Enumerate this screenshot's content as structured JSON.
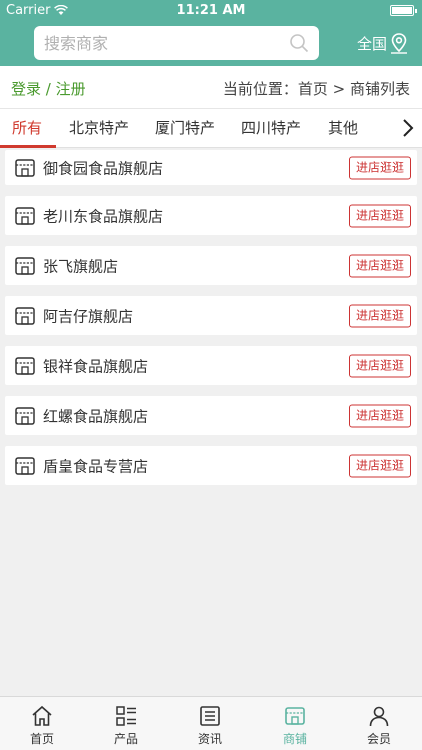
{
  "status_bar": {
    "carrier": "Carrier",
    "time": "11:21 AM"
  },
  "header": {
    "search": {
      "placeholder": "搜索商家",
      "icon": "search-icon"
    },
    "region": {
      "label": "全国",
      "icon": "location-pin-icon"
    }
  },
  "info_bar": {
    "auth": "登录 / 注册",
    "breadcrumb": "当前位置：首页 > 商铺列表"
  },
  "category_tabs": {
    "items": [
      "所有",
      "北京特产",
      "厦门特产",
      "四川特产",
      "其他"
    ],
    "active": "所有",
    "more_icon": "chevron-right-icon"
  },
  "stores": [
    {
      "name": "御食园食品旗舰店",
      "action": "进店逛逛"
    },
    {
      "name": "老川东食品旗舰店",
      "action": "进店逛逛"
    },
    {
      "name": "张飞旗舰店",
      "action": "进店逛逛"
    },
    {
      "name": "阿吉仔旗舰店",
      "action": "进店逛逛"
    },
    {
      "name": "银祥食品旗舰店",
      "action": "进店逛逛"
    },
    {
      "name": "红螺食品旗舰店",
      "action": "进店逛逛"
    },
    {
      "name": "盾皇食品专营店",
      "action": "进店逛逛"
    }
  ],
  "tab_bar": {
    "items": [
      {
        "label": "首页",
        "icon": "home-icon"
      },
      {
        "label": "产品",
        "icon": "product-list-icon"
      },
      {
        "label": "资讯",
        "icon": "news-icon"
      },
      {
        "label": "商铺",
        "icon": "store-icon"
      },
      {
        "label": "会员",
        "icon": "member-icon"
      }
    ],
    "active": "商铺"
  },
  "colors": {
    "brand": "#5ab3a0",
    "accent_red": "#d03a2e",
    "auth_green": "#4a9a2e"
  }
}
